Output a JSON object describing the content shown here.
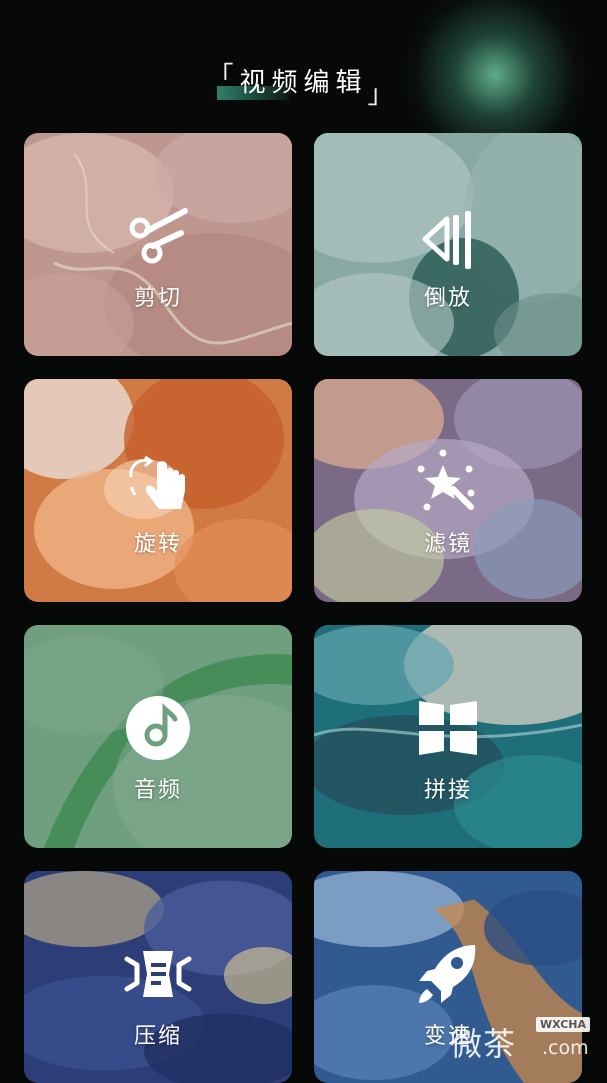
{
  "header": {
    "title": "视频编辑",
    "bracket_left": "「",
    "bracket_right": "」"
  },
  "tiles": [
    {
      "label": "剪切",
      "icon": "scissors-icon"
    },
    {
      "label": "倒放",
      "icon": "reverse-play-icon"
    },
    {
      "label": "旋转",
      "icon": "rotate-hand-icon"
    },
    {
      "label": "滤镜",
      "icon": "magic-wand-icon"
    },
    {
      "label": "音频",
      "icon": "music-note-icon"
    },
    {
      "label": "拼接",
      "icon": "grid-tiles-icon"
    },
    {
      "label": "压缩",
      "icon": "compress-icon"
    },
    {
      "label": "变速",
      "icon": "rocket-icon"
    }
  ],
  "watermark": {
    "text": "微茶",
    "badge": "WXCHA",
    "domain": ".com"
  }
}
